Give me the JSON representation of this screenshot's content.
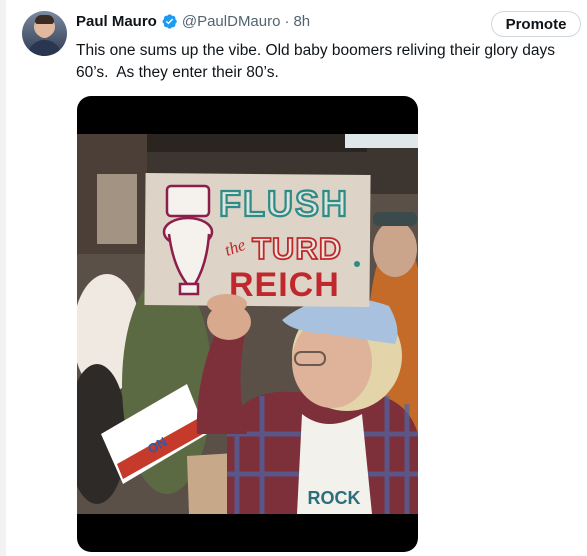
{
  "tweet": {
    "author_name": "Paul Mauro",
    "handle": "@PaulDMauro",
    "separator": "·",
    "time": "8h",
    "text": "This one sums up the vibe. Old baby boomers reliving their glory days\n60’s.  As they enter their 80’s."
  },
  "actions": {
    "promote_label": "Promote"
  },
  "media": {
    "sign": {
      "line1": "FLUSH",
      "line2_small": "the",
      "line2": "TURD",
      "line3": "REICH"
    },
    "background_sign": "ON",
    "shirt_text": "ROCK"
  },
  "colors": {
    "verified_blue": "#1d9bf0",
    "sign_teal": "#2e8b86",
    "sign_red": "#c0282e"
  },
  "icons": {
    "verified": "verified-badge-icon"
  }
}
